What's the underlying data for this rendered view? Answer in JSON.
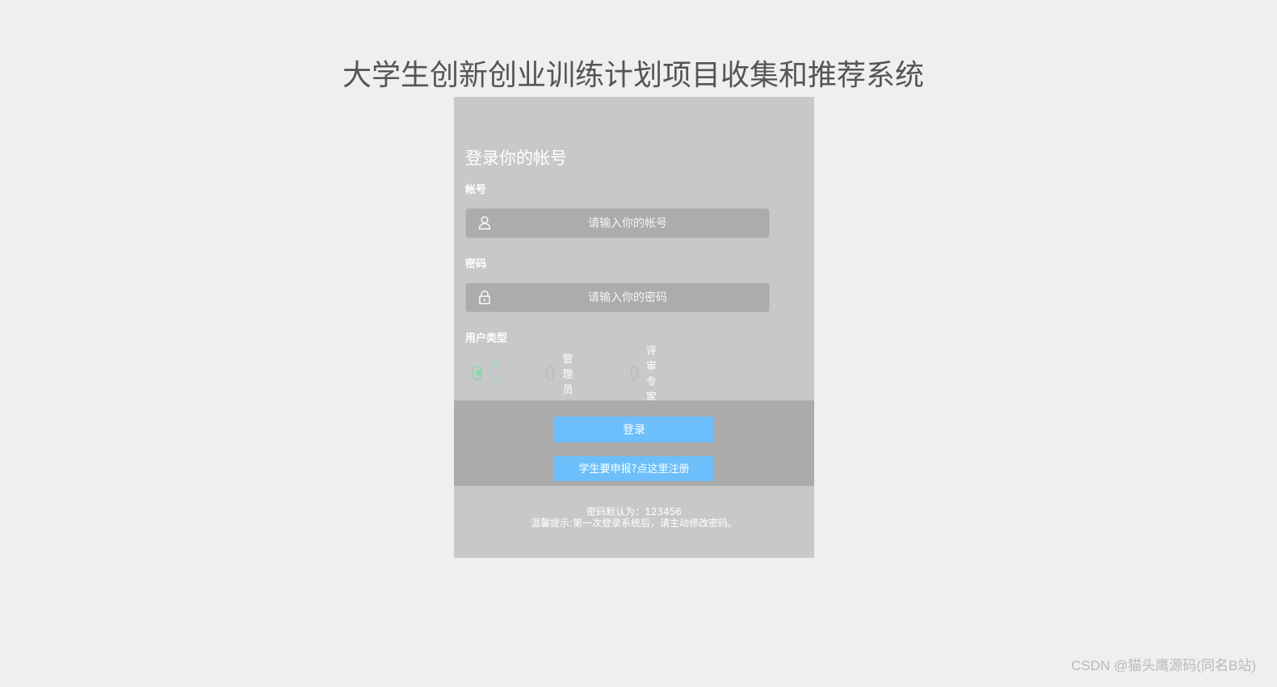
{
  "page": {
    "title": "大学生创新创业训练计划项目收集和推荐系统"
  },
  "login": {
    "heading": "登录你的帐号",
    "account": {
      "label": "帐号",
      "placeholder": "请输入你的帐号",
      "value": "",
      "icon": "user-icon"
    },
    "password": {
      "label": "密码",
      "placeholder": "请输入你的密码",
      "value": "",
      "icon": "lock-icon"
    },
    "user_type": {
      "label": "用户类型",
      "options": [
        {
          "label": "学生",
          "checked": true
        },
        {
          "label": "管理员",
          "checked": false
        },
        {
          "label": "评审专家",
          "checked": false
        }
      ]
    },
    "login_button": "登录",
    "register_button": "学生要申报?点这里注册",
    "tips": {
      "line1": "密码默认为：123456",
      "line2": "温馨提示:第一次登录系统后，请主动修改密码。"
    }
  },
  "watermark": "CSDN @猫头鹰源码(同名B站)",
  "colors": {
    "background": "#efefef",
    "card": "#c8c8c8",
    "action_band": "#ababab",
    "input": "#acacac",
    "button": "#6cbffa",
    "radio_checked": "#8fd6ac"
  }
}
